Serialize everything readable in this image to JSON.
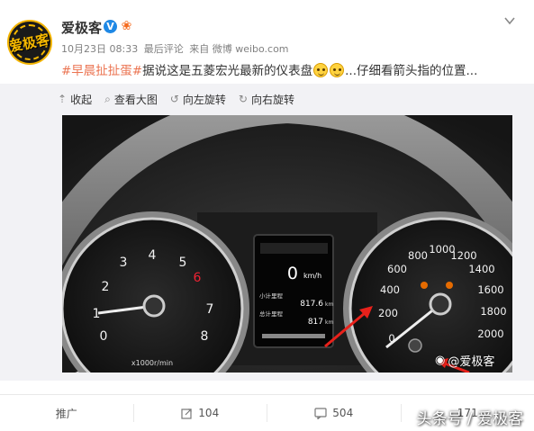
{
  "user": {
    "name": "爱极客",
    "avatar_text": "爱极客",
    "verified_symbol": "V",
    "vip_symbol": "❀"
  },
  "meta": {
    "date": "10月23日 08:33",
    "last_comment": "最后评论",
    "source": "来自 微博 weibo.com"
  },
  "post": {
    "hashtag": "#早晨扯扯蛋#",
    "text_before_emoji": "据说这是五菱宏光最新的仪表盘",
    "text_after_emoji": "...仔细看箭头指的位置..."
  },
  "toolbar": {
    "collapse": "收起",
    "view_large": "查看大图",
    "rotate_left": "向左旋转",
    "rotate_right": "向右旋转"
  },
  "image": {
    "speed_display": "0",
    "speed_unit": "km/h",
    "odo_label_1": "小计里程",
    "odo_value_1": "817.6",
    "odo_label_2": "总计里程",
    "odo_value_2": "817",
    "odo_unit": "km",
    "tach_unit": "x1000r/min",
    "tach_labels": [
      "0",
      "1",
      "2",
      "3",
      "4",
      "5",
      "6",
      "7",
      "8"
    ],
    "speed_labels": [
      "0",
      "200",
      "400",
      "600",
      "800",
      "1000",
      "1200",
      "1400",
      "1600",
      "1800",
      "2000"
    ],
    "watermark": "@爱极客"
  },
  "actions": {
    "promote": "推广",
    "repost_count": "104",
    "comment_count": "504",
    "like_count": "171"
  },
  "site_watermark": "头条号 / 爱极客"
}
